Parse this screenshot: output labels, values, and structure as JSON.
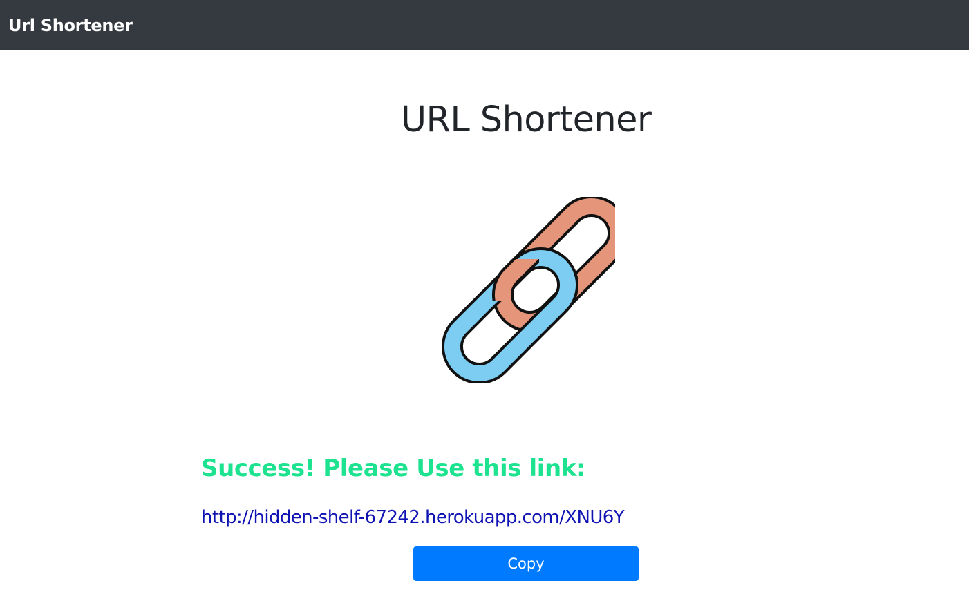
{
  "navbar": {
    "brand": "Url Shortener",
    "background": "#343a40"
  },
  "main": {
    "title": "URL Shortener",
    "logo_icon": "chain-link-icon",
    "logo_colors": {
      "top_link": "#e4957a",
      "bottom_link": "#7dcdf2",
      "outline": "#111111"
    },
    "success_message": "Success! Please Use this link:",
    "success_color": "#1de28f",
    "short_url": "http://hidden-shelf-67242.herokuapp.com/XNU6Y",
    "link_color": "#0f13b3",
    "copy_button_label": "Copy",
    "copy_button_color": "#007bff"
  }
}
